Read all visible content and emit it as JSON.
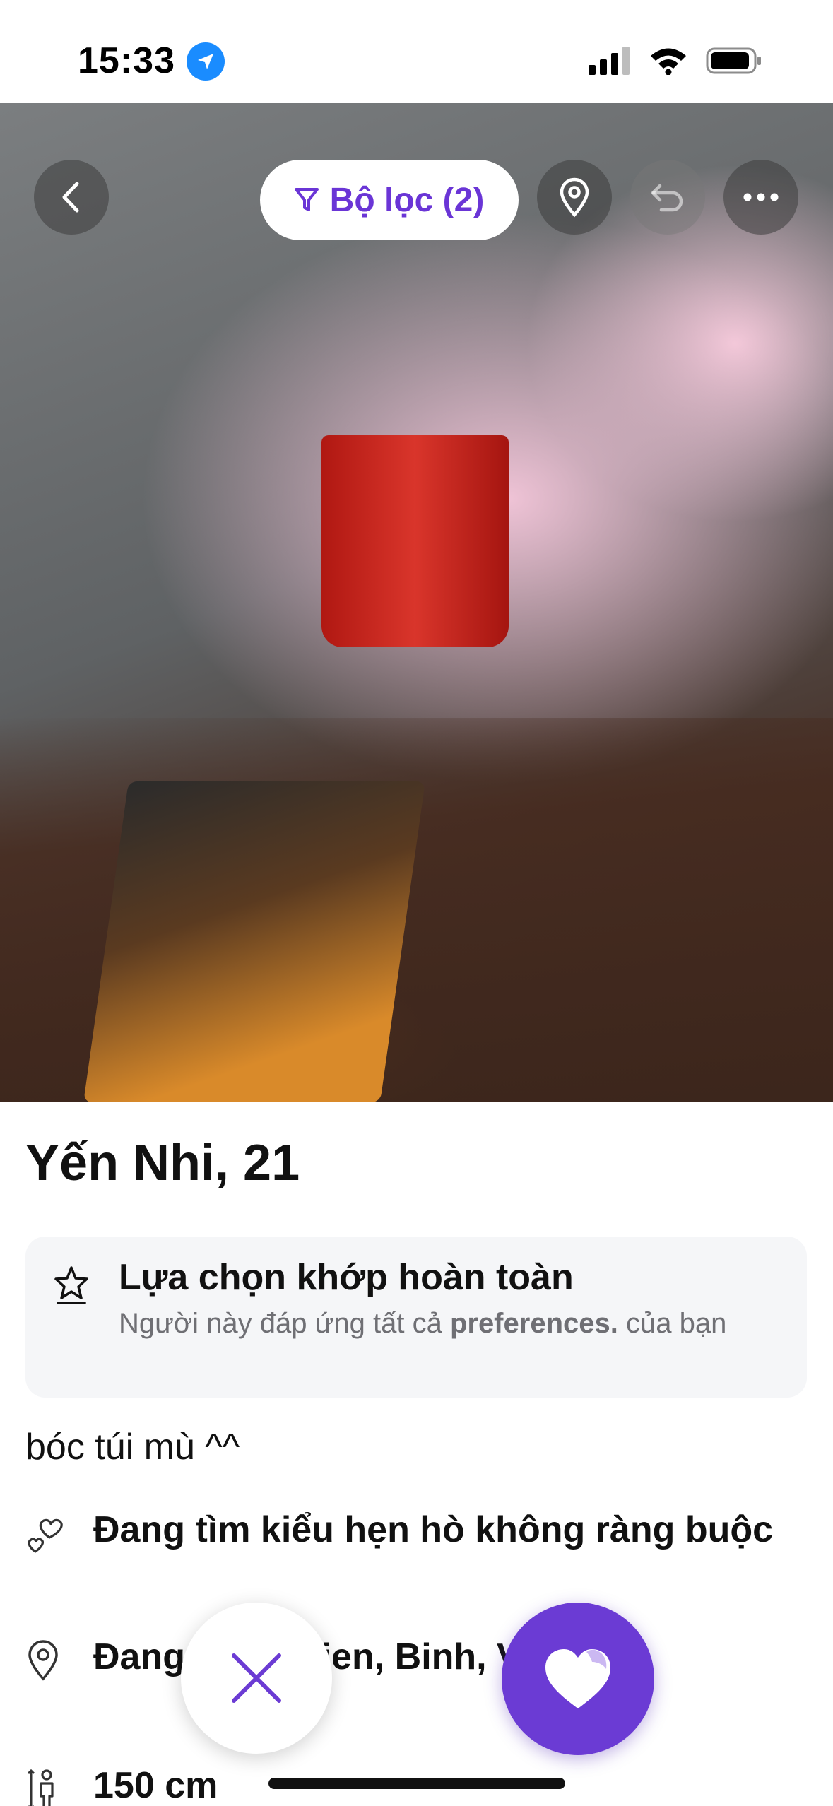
{
  "status_bar": {
    "time": "15:33",
    "icons": [
      "location-arrow-icon",
      "cellular-signal-icon",
      "wifi-icon",
      "battery-icon"
    ]
  },
  "header": {
    "back_icon": "chevron-left-icon",
    "filter_label": "Bộ lọc (2)",
    "filter_icon": "funnel-icon",
    "location_icon": "map-pin-icon",
    "undo_icon": "undo-icon",
    "more_icon": "more-horizontal-icon"
  },
  "profile": {
    "name_age": "Yến Nhi, 21",
    "match": {
      "icon": "star-badge-icon",
      "title": "Lựa chọn khớp hoàn toàn",
      "desc_prefix": "Người này đáp ứng tất cả ",
      "desc_bold": "preferences.",
      "desc_suffix": " của bạn"
    },
    "bio": "bóc túi mù ^^",
    "info": [
      {
        "icon": "hearts-icon",
        "text": "Đang tìm kiểu hẹn hò không ràng buộc"
      },
      {
        "icon": "map-pin-icon",
        "text": "Đang Song Vien, Binh, Vietnam"
      },
      {
        "icon": "height-icon",
        "text": "150 cm"
      }
    ]
  },
  "actions": {
    "dislike_icon": "close-icon",
    "like_icon": "heart-icon"
  },
  "colors": {
    "accent": "#6b3bd4",
    "filter_text": "#6a35d6",
    "card_bg": "#f5f6f8",
    "muted_text": "#6f6f74"
  }
}
